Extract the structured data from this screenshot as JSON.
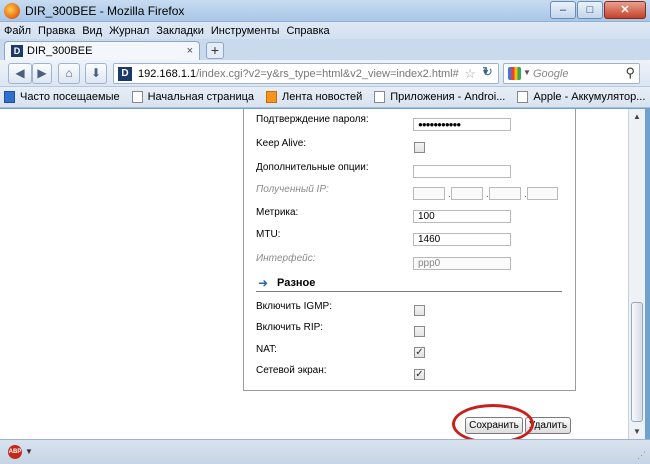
{
  "window": {
    "title": "DIR_300BEE - Mozilla Firefox",
    "minimize": "–",
    "maximize": "□",
    "close": "✕"
  },
  "menu": [
    "Файл",
    "Правка",
    "Вид",
    "Журнал",
    "Закладки",
    "Инструменты",
    "Справка"
  ],
  "tab": {
    "label": "DIR_300BEE",
    "close": "×",
    "new": "+"
  },
  "nav": {
    "url_host": "192.168.1.1",
    "url_rest": "/index.cgi?v2=y&rs_type=html&v2_view=index2.html#",
    "search_placeholder": "Google",
    "back": "◀",
    "forward": "▶",
    "home": "⌂",
    "download": "⬇",
    "reload": "↻",
    "star": "☆",
    "drop": "▼",
    "search": "⚲"
  },
  "bookmarks": [
    {
      "label": "Часто посещаемые",
      "icon": "bookmark-icon"
    },
    {
      "label": "Начальная страница",
      "icon": "page-icon"
    },
    {
      "label": "Лента новостей",
      "icon": "rss-icon"
    },
    {
      "label": "Приложения - Androi...",
      "icon": "page-icon"
    },
    {
      "label": "Apple - Аккумулятор...",
      "icon": "page-icon"
    }
  ],
  "form": {
    "password_confirm_label": "Подтверждение пароля:",
    "password_confirm_value": "●●●●●●●●●●●",
    "keepalive_label": "Keep Alive:",
    "extra_options_label": "Дополнительные опции:",
    "extra_options_value": "",
    "received_ip_label": "Полученный IP:",
    "ip_dot": ".",
    "metric_label": "Метрика:",
    "metric_value": "100",
    "mtu_label": "MTU:",
    "mtu_value": "1460",
    "interface_label": "Интерфейс:",
    "interface_value": "ppp0",
    "misc_title": "Разное",
    "igmp_label": "Включить IGMP:",
    "igmp_checked": false,
    "rip_label": "Включить RIP:",
    "rip_checked": false,
    "nat_label": "NAT:",
    "nat_checked": true,
    "firewall_label": "Сетевой экран:",
    "firewall_checked": true,
    "check_mark": "✓"
  },
  "buttons": {
    "save": "Сохранить",
    "delete": "Удалить"
  },
  "status": {
    "abp": "ABP",
    "drop": "▼",
    "grip": "⋰"
  },
  "colors": {
    "highlight_ring": "#c7211c",
    "titlebar": "#a9c6e6"
  }
}
